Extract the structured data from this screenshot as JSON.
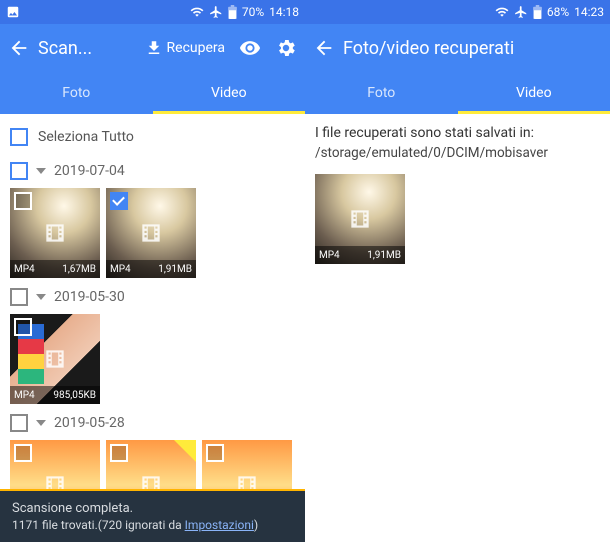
{
  "left": {
    "status": {
      "battery": "70%",
      "time": "14:18"
    },
    "appbar": {
      "title": "Scan...",
      "recover": "Recupera"
    },
    "tabs": {
      "foto": "Foto",
      "video": "Video",
      "active": "video"
    },
    "select_all": "Seleziona Tutto",
    "groups": [
      {
        "date": "2019-07-04",
        "checked": true,
        "items": [
          {
            "fmt": "MP4",
            "size": "1,67MB",
            "checked": false
          },
          {
            "fmt": "MP4",
            "size": "1,91MB",
            "checked": true
          }
        ]
      },
      {
        "date": "2019-05-30",
        "checked": false,
        "items": [
          {
            "fmt": "MP4",
            "size": "985,05KB",
            "checked": false
          }
        ]
      },
      {
        "date": "2019-05-28",
        "checked": false,
        "items": [
          {
            "fmt": "",
            "size": "",
            "checked": false
          },
          {
            "fmt": "",
            "size": "",
            "checked": false,
            "badge": true
          },
          {
            "fmt": "",
            "size": "",
            "checked": false
          }
        ]
      }
    ],
    "toast": {
      "line1": "Scansione completa.",
      "line2_pre": "1171 file trovati.(720 ignorati da ",
      "line2_link": "Impostazioni",
      "line2_post": ")"
    }
  },
  "right": {
    "status": {
      "battery": "68%",
      "time": "14:23"
    },
    "appbar": {
      "title": "Foto/video recuperati"
    },
    "tabs": {
      "foto": "Foto",
      "video": "Video",
      "active": "video"
    },
    "message": "I file recuperati sono stati salvati in:",
    "path": "/storage/emulated/0/DCIM/mobisaver",
    "items": [
      {
        "fmt": "MP4",
        "size": "1,91MB"
      }
    ]
  }
}
